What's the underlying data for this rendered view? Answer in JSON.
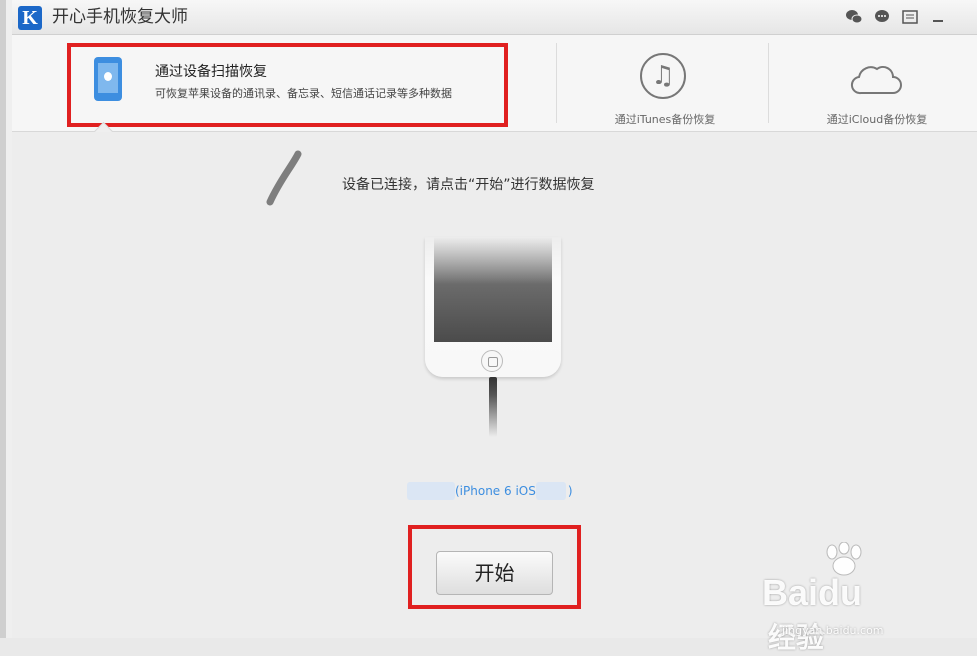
{
  "app": {
    "title": "开心手机恢复大师",
    "logo_letter": "K"
  },
  "titlebar": {
    "icons": [
      "wechat-icon",
      "chat-bubble-icon",
      "menu-icon",
      "minimize-icon"
    ]
  },
  "tabs": {
    "device_scan": {
      "title": "通过设备扫描恢复",
      "desc": "可恢复苹果设备的通讯录、备忘录、短信通话记录等多种数据"
    },
    "itunes": {
      "label": "通过iTunes备份恢复"
    },
    "icloud": {
      "label": "通过iCloud备份恢复"
    }
  },
  "main": {
    "status": "设备已连接，请点击“开始”进行数据恢复",
    "device_name": "(iPhone 6 iOS",
    "device_name_end": ")",
    "start_label": "开始"
  },
  "watermark": {
    "brand": "Bai",
    "brand2": "du",
    "cn": "经验",
    "url": "jingyan.baidu.com"
  },
  "colors": {
    "accent": "#3d8ee0",
    "highlight": "#e02020",
    "logo": "#1c68c8"
  }
}
